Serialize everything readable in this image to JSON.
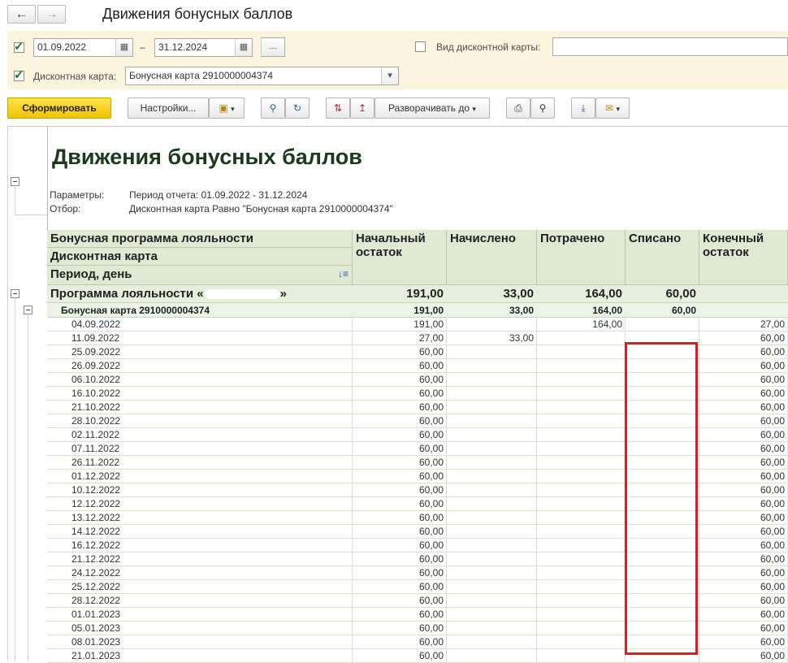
{
  "window": {
    "title": "Движения бонусных баллов",
    "back_icon": "arrow-left-icon",
    "forward_icon": "arrow-right-icon"
  },
  "filters": {
    "date_from": "01.09.2022",
    "date_sep": "–",
    "date_to": "31.12.2024",
    "more_label": "...",
    "card_type_label": "Вид дисконтной карты:",
    "card_type_value": "",
    "card_label": "Дисконтная карта:",
    "card_value": "Бонусная карта 2910000004374"
  },
  "toolbar": {
    "generate": "Сформировать",
    "settings": "Настройки...",
    "expand_to": "Разворачивать до"
  },
  "report": {
    "title": "Движения бонусных баллов",
    "params_label": "Параметры:",
    "params_value": "Период отчета: 01.09.2022 - 31.12.2024",
    "filter_label": "Отбор:",
    "filter_value": "Дисконтная карта Равно \"Бонусная карта 2910000004374\"",
    "headers": {
      "group1": "Бонусная программа лояльности",
      "group2": "Дисконтная карта",
      "group3": "Период, день",
      "start": "Начальный остаток",
      "accrued": "Начислено",
      "spent": "Потрачено",
      "written_off": "Списано",
      "end": "Конечный остаток"
    },
    "program_row": {
      "name": "Программа лояльности «",
      "name_end": "»",
      "start": "191,00",
      "accrued": "33,00",
      "spent": "164,00",
      "written_off": "60,00",
      "end": ""
    },
    "card_row": {
      "name": "Бонусная карта 2910000004374",
      "start": "191,00",
      "accrued": "33,00",
      "spent": "164,00",
      "written_off": "60,00",
      "end": ""
    },
    "rows": [
      {
        "date": "04.09.2022",
        "start": "191,00",
        "accrued": "",
        "spent": "164,00",
        "written_off": "",
        "end": "27,00"
      },
      {
        "date": "11.09.2022",
        "start": "27,00",
        "accrued": "33,00",
        "spent": "",
        "written_off": "",
        "end": "60,00"
      },
      {
        "date": "25.09.2022",
        "start": "60,00",
        "accrued": "",
        "spent": "",
        "written_off": "",
        "end": "60,00"
      },
      {
        "date": "26.09.2022",
        "start": "60,00",
        "accrued": "",
        "spent": "",
        "written_off": "",
        "end": "60,00"
      },
      {
        "date": "06.10.2022",
        "start": "60,00",
        "accrued": "",
        "spent": "",
        "written_off": "",
        "end": "60,00"
      },
      {
        "date": "16.10.2022",
        "start": "60,00",
        "accrued": "",
        "spent": "",
        "written_off": "",
        "end": "60,00"
      },
      {
        "date": "21.10.2022",
        "start": "60,00",
        "accrued": "",
        "spent": "",
        "written_off": "",
        "end": "60,00"
      },
      {
        "date": "28.10.2022",
        "start": "60,00",
        "accrued": "",
        "spent": "",
        "written_off": "",
        "end": "60,00"
      },
      {
        "date": "02.11.2022",
        "start": "60,00",
        "accrued": "",
        "spent": "",
        "written_off": "",
        "end": "60,00"
      },
      {
        "date": "07.11.2022",
        "start": "60,00",
        "accrued": "",
        "spent": "",
        "written_off": "",
        "end": "60,00"
      },
      {
        "date": "26.11.2022",
        "start": "60,00",
        "accrued": "",
        "spent": "",
        "written_off": "",
        "end": "60,00"
      },
      {
        "date": "01.12.2022",
        "start": "60,00",
        "accrued": "",
        "spent": "",
        "written_off": "",
        "end": "60,00"
      },
      {
        "date": "10.12.2022",
        "start": "60,00",
        "accrued": "",
        "spent": "",
        "written_off": "",
        "end": "60,00"
      },
      {
        "date": "12.12.2022",
        "start": "60,00",
        "accrued": "",
        "spent": "",
        "written_off": "",
        "end": "60,00"
      },
      {
        "date": "13.12.2022",
        "start": "60,00",
        "accrued": "",
        "spent": "",
        "written_off": "",
        "end": "60,00"
      },
      {
        "date": "14.12.2022",
        "start": "60,00",
        "accrued": "",
        "spent": "",
        "written_off": "",
        "end": "60,00"
      },
      {
        "date": "16.12.2022",
        "start": "60,00",
        "accrued": "",
        "spent": "",
        "written_off": "",
        "end": "60,00"
      },
      {
        "date": "21.12.2022",
        "start": "60,00",
        "accrued": "",
        "spent": "",
        "written_off": "",
        "end": "60,00"
      },
      {
        "date": "24.12.2022",
        "start": "60,00",
        "accrued": "",
        "spent": "",
        "written_off": "",
        "end": "60,00"
      },
      {
        "date": "25.12.2022",
        "start": "60,00",
        "accrued": "",
        "spent": "",
        "written_off": "",
        "end": "60,00"
      },
      {
        "date": "28.12.2022",
        "start": "60,00",
        "accrued": "",
        "spent": "",
        "written_off": "",
        "end": "60,00"
      },
      {
        "date": "01.01.2023",
        "start": "60,00",
        "accrued": "",
        "spent": "",
        "written_off": "",
        "end": "60,00"
      },
      {
        "date": "05.01.2023",
        "start": "60,00",
        "accrued": "",
        "spent": "",
        "written_off": "",
        "end": "60,00"
      },
      {
        "date": "08.01.2023",
        "start": "60,00",
        "accrued": "",
        "spent": "",
        "written_off": "",
        "end": "60,00"
      },
      {
        "date": "21.01.2023",
        "start": "60,00",
        "accrued": "",
        "spent": "",
        "written_off": "",
        "end": "60,00"
      }
    ]
  },
  "colors": {
    "header_bg": "#dfe9d3",
    "highlight": "#e01b24",
    "generate_btn": "#f1c400",
    "filter_panel": "#fbf5de"
  }
}
